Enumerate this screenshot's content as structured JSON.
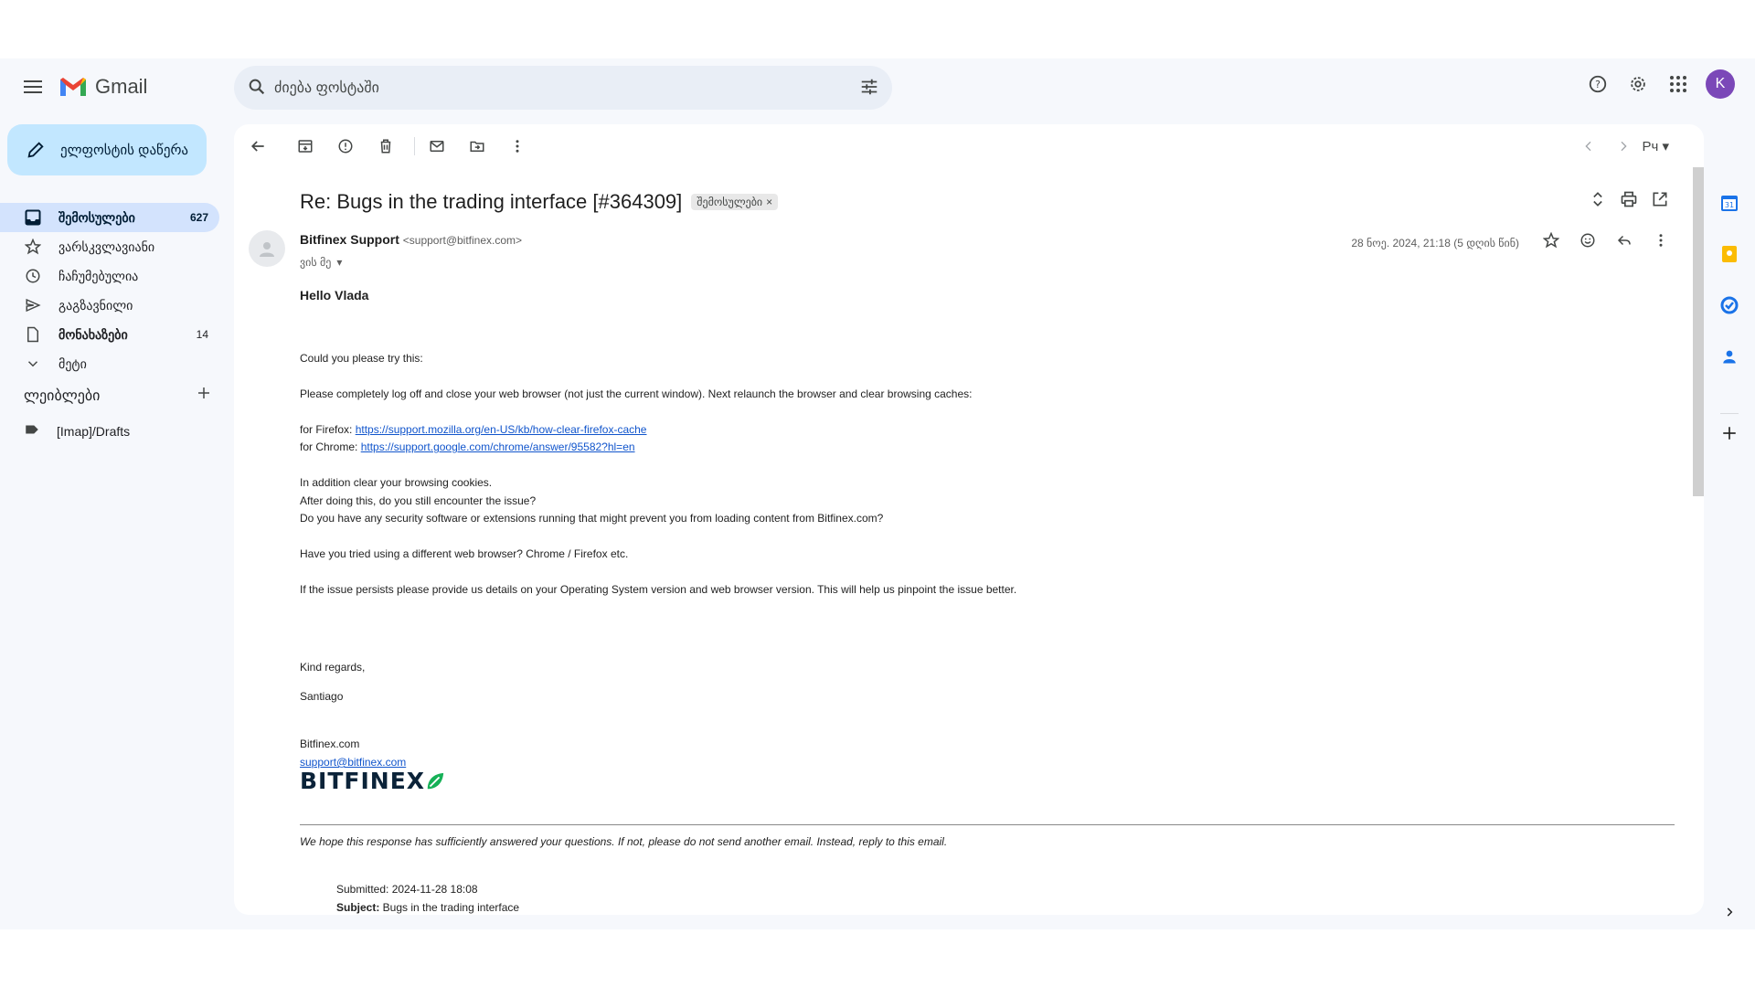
{
  "app": {
    "name": "Gmail"
  },
  "search": {
    "placeholder": "ძიება ფოსტაში"
  },
  "account": {
    "avatar_letter": "K"
  },
  "compose": {
    "label": "ელფოსტის დაწერა"
  },
  "nav": [
    {
      "label": "შემოსულები",
      "count": "627",
      "icon": "inbox-icon"
    },
    {
      "label": "ვარსკვლავიანი",
      "count": "",
      "icon": "star-icon"
    },
    {
      "label": "ჩაჩუმებულია",
      "count": "",
      "icon": "clock-icon"
    },
    {
      "label": "გაგზავნილი",
      "count": "",
      "icon": "send-icon"
    },
    {
      "label": "მონახაზები",
      "count": "14",
      "icon": "draft-icon"
    },
    {
      "label": "მეტი",
      "count": "",
      "icon": "chevron-down-icon"
    }
  ],
  "labels": {
    "title": "ლეიბლები",
    "items": [
      {
        "label": "[Imap]/Drafts"
      }
    ]
  },
  "toolbar": {
    "language": "Рч"
  },
  "email": {
    "subject": "Re: Bugs in the trading interface [#364309]",
    "label_chip": "შემოსულები",
    "sender_name": "Bitfinex Support",
    "sender_email": "<support@bitfinex.com>",
    "to": "ვის მე",
    "date": "28 ნოე. 2024, 21:18 (5 დღის წინ)",
    "body": {
      "greeting": "Hello Vlada",
      "line1": "Could you please try this:",
      "line2": "Please completely log off and close your web browser (not just the current window). Next relaunch the browser and clear browsing caches:",
      "firefox_prefix": "for Firefox: ",
      "firefox_link": "https://support.mozilla.org/en-US/kb/how-clear-firefox-cache",
      "chrome_prefix": "for Chrome: ",
      "chrome_link": "https://support.google.com/chrome/answer/95582?hl=en",
      "line3": "In addition clear your browsing cookies.",
      "line4": "After doing this, do you still encounter the issue?",
      "line5": "Do you have any security software or extensions running that might prevent you from loading content from Bitfinex.com?",
      "line6": "Have you tried using a different web browser? Chrome / Firefox etc.",
      "line7": "If the issue persists please provide us details on your Operating System version and web browser version. This will help us pinpoint the issue better.",
      "regards": "Kind regards,",
      "signer": "Santiago",
      "company": "Bitfinex.com",
      "support_email": "support@bitfinex.com",
      "logo_text": "BITFINEX",
      "disclaimer": "We hope this response has sufficiently answered your questions. If not, please do not send another email. Instead, reply to this email.",
      "submitted": "Submitted: 2024-11-28 18:08",
      "subject_label": "Subject:",
      "subject_value": " Bugs in the trading interface"
    }
  },
  "colors": {
    "accent": "#0b57d0",
    "compose_bg": "#c2e7ff",
    "active_nav": "#d3e3fd",
    "avatar": "#7b48b8",
    "bitfinex_green": "#16b157"
  }
}
